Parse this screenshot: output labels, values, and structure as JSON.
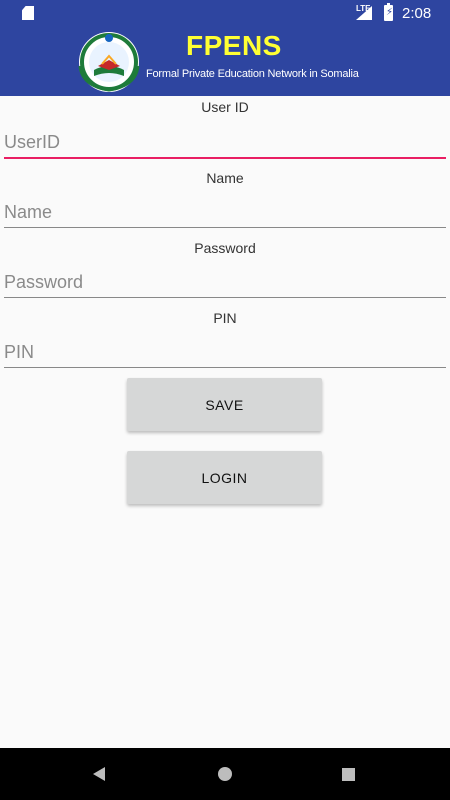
{
  "status_bar": {
    "network": "LTE",
    "time": "2:08"
  },
  "header": {
    "title": "FPENS",
    "subtitle": "Formal Private Education Network in Somalia",
    "logo_icon": "fpens-logo-icon"
  },
  "form": {
    "fields": [
      {
        "label": "User ID",
        "placeholder": "UserID",
        "value": ""
      },
      {
        "label": "Name",
        "placeholder": "Name",
        "value": ""
      },
      {
        "label": "Password",
        "placeholder": "Password",
        "value": ""
      },
      {
        "label": "PIN",
        "placeholder": "PIN",
        "value": ""
      }
    ],
    "save_label": "SAVE",
    "login_label": "LOGIN"
  },
  "colors": {
    "primary": "#2e45a0",
    "title": "#ffff33",
    "accent": "#e91e63"
  }
}
